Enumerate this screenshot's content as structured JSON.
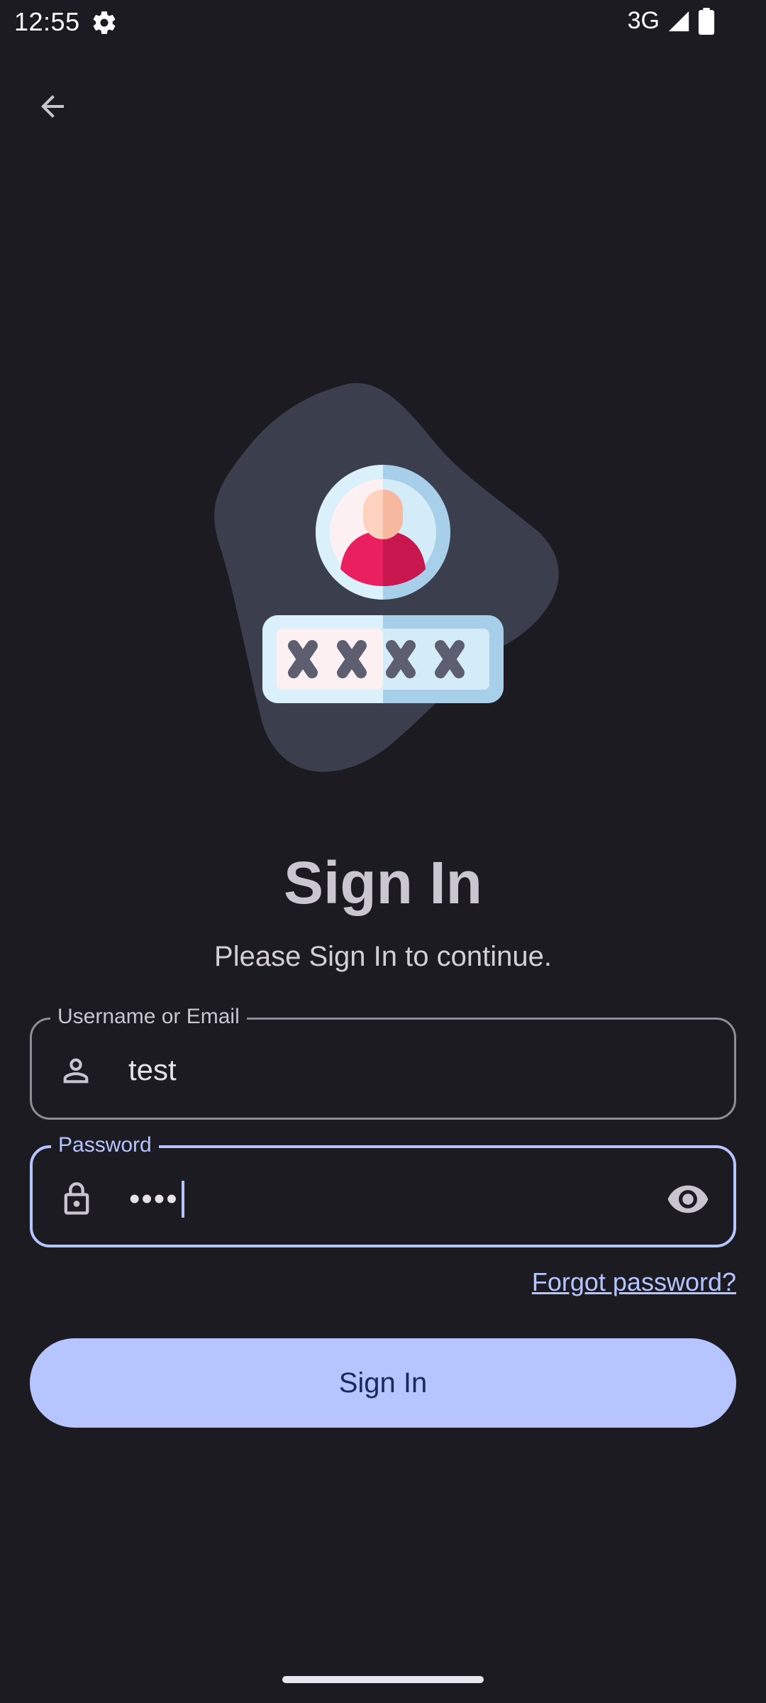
{
  "status_bar": {
    "time": "12:55",
    "network": "3G",
    "icons": [
      "gear-icon",
      "signal-icon",
      "battery-icon"
    ]
  },
  "nav": {
    "back_icon": "arrow-back-icon"
  },
  "illustration": {
    "name": "user-login-illustration",
    "colors": {
      "blob": "#3b3e4c",
      "avatar_ring": "#daf0fb",
      "avatar_shadow": "#a8cfe9",
      "person_shirt": "#e91f5f",
      "person_face": "#fdd3bf",
      "password_box": "#daf0fb",
      "password_marks": "#5d5f70"
    }
  },
  "header": {
    "title": "Sign In",
    "subtitle": "Please Sign In to continue."
  },
  "form": {
    "username": {
      "label": "Username or Email",
      "value": "test",
      "icon": "person-icon"
    },
    "password": {
      "label": "Password",
      "masked_value": "••••",
      "icon": "lock-icon",
      "toggle_icon": "eye-icon"
    },
    "forgot_password": "Forgot password?",
    "submit_label": "Sign In"
  },
  "colors": {
    "background": "#1b1b21",
    "accent": "#b6c4ff",
    "outline": "#8f8d98",
    "button_text": "#1a2a5a"
  }
}
